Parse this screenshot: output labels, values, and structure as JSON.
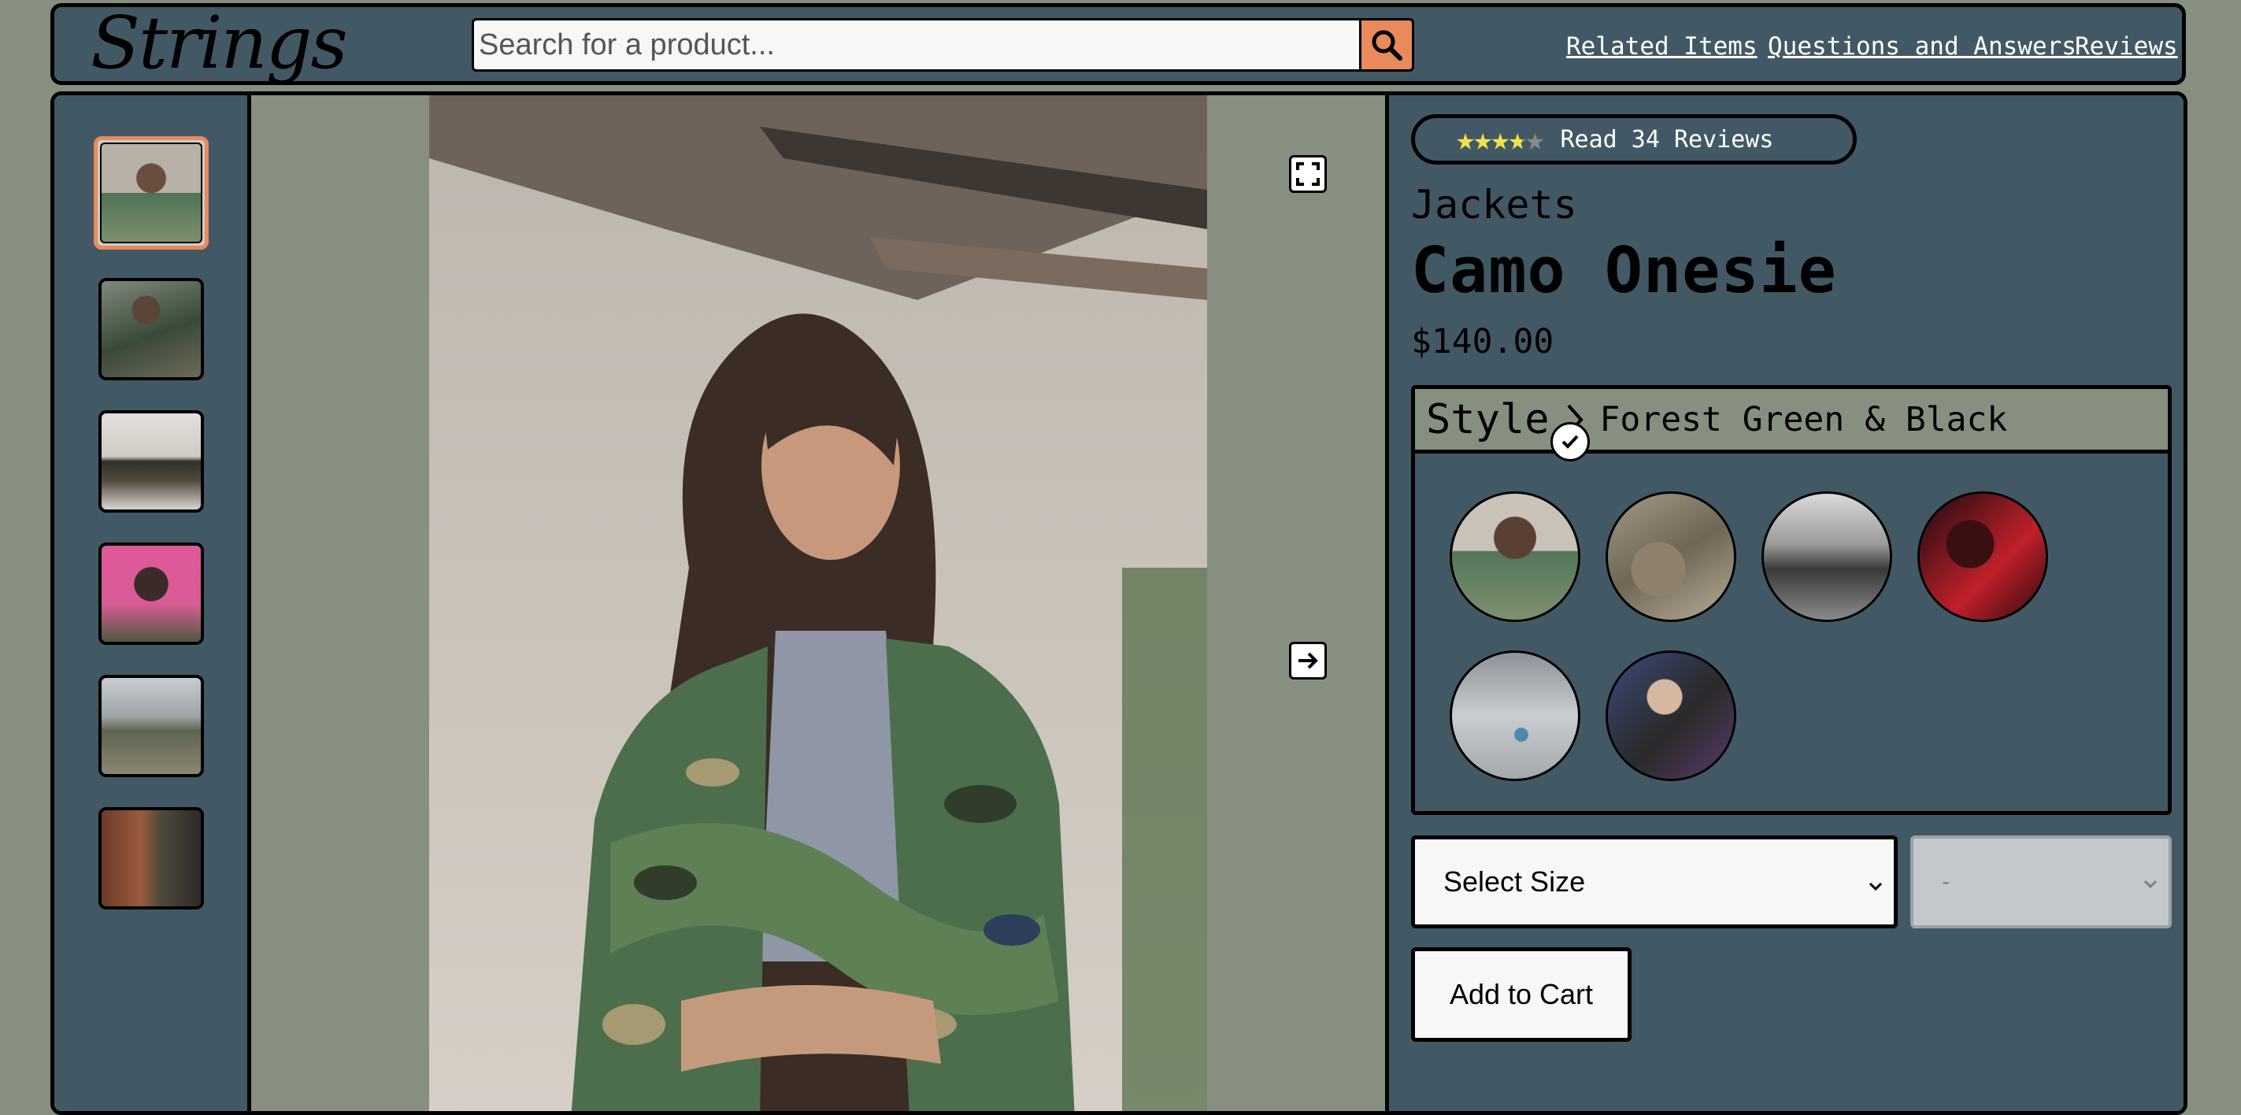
{
  "header": {
    "logo": "Strings",
    "search_placeholder": "Search for a product...",
    "nav_links": [
      "Related Items",
      "Questions and Answers",
      "Reviews"
    ]
  },
  "gallery": {
    "thumbnail_count": 6,
    "active_thumbnail_index": 0
  },
  "product": {
    "rating": 3.75,
    "rating_max": 5,
    "reviews_link": "Read 34 Reviews",
    "category": "Jackets",
    "name": "Camo Onesie",
    "price": "$140.00"
  },
  "style": {
    "label": "Style",
    "selected_name": "Forest Green & Black",
    "swatch_count": 6,
    "selected_index": 0
  },
  "cart": {
    "size_select": "Select Size",
    "quantity_select": "-",
    "add_to_cart": "Add to Cart"
  },
  "colors": {
    "accent": "#e88a5b",
    "panel": "#425965",
    "background": "#879080",
    "star_filled": "#f5e04a",
    "star_empty": "#8a8a8a"
  }
}
